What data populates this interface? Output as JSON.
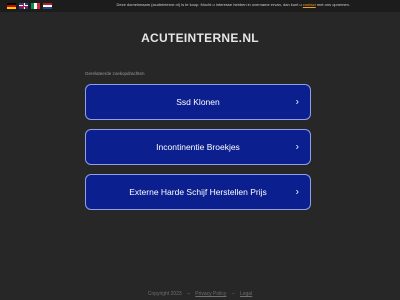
{
  "topbar": {
    "languages": [
      {
        "code": "de",
        "icon": "german-flag-icon"
      },
      {
        "code": "en",
        "icon": "uk-flag-icon"
      },
      {
        "code": "it",
        "icon": "italian-flag-icon"
      },
      {
        "code": "nl",
        "icon": "dutch-flag-icon"
      }
    ],
    "notice_text": "Deze domeinnaam (acuteinterne.nl) is te koop. Mocht u interesse hebben in overname ervan, dan kunt u",
    "notice_link": "contact",
    "notice_suffix": "met ons opnemen."
  },
  "site": {
    "title": "ACUTEINTERNE.NL"
  },
  "related": {
    "label": "Gerelateerde zoekopdrachten",
    "items": [
      {
        "label": "Ssd Klonen"
      },
      {
        "label": "Incontinentie Broekjes"
      },
      {
        "label": "Externe Harde Schijf Herstellen Prijs"
      }
    ],
    "chevron": "›"
  },
  "footer": {
    "copyright": "Copyright 2023",
    "privacy": "Privacy Policy",
    "legal": "Legal",
    "separator": "–"
  },
  "colors": {
    "background": "#272727",
    "button_fill": "#0b1f8f",
    "button_border": "#8fa0e8",
    "link_accent": "#f0a020"
  }
}
